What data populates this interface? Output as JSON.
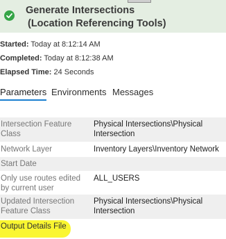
{
  "header": {
    "title_line1": "Generate Intersections",
    "title_line2": "(Location Referencing Tools)",
    "status_icon": "check-circle-icon",
    "status_color": "#35a547"
  },
  "meta": {
    "started_label": "Started:",
    "started_value": "Today at 8:12:14 AM",
    "completed_label": "Completed:",
    "completed_value": "Today at 8:12:38 AM",
    "elapsed_label": "Elapsed Time:",
    "elapsed_value": "24 Seconds"
  },
  "tabs": [
    {
      "label": "Parameters",
      "active": true
    },
    {
      "label": "Environments",
      "active": false
    },
    {
      "label": "Messages",
      "active": false
    }
  ],
  "parameters": [
    {
      "label_line1": "Intersection Feature",
      "label_line2": "Class",
      "value_line1": "Physical Intersections\\Physical",
      "value_line2": "Intersection"
    },
    {
      "label_line1": "Network Layer",
      "label_line2": "",
      "value_line1": "Inventory Layers\\Inventory Network",
      "value_line2": ""
    },
    {
      "label_line1": "Start Date",
      "label_line2": "",
      "value_line1": "",
      "value_line2": ""
    },
    {
      "label_line1": "Only use routes edited",
      "label_line2": "by current user",
      "value_line1": "ALL_USERS",
      "value_line2": ""
    },
    {
      "label_line1": "Updated Intersection",
      "label_line2": "Feature Class",
      "value_line1": "Physical Intersections\\Physical",
      "value_line2": "Intersection"
    }
  ],
  "output_details_label": "Output Details File",
  "colors": {
    "highlight": "#faf631",
    "active_tab_underline": "#1a7fd0",
    "header_background": "#e4eee2"
  }
}
